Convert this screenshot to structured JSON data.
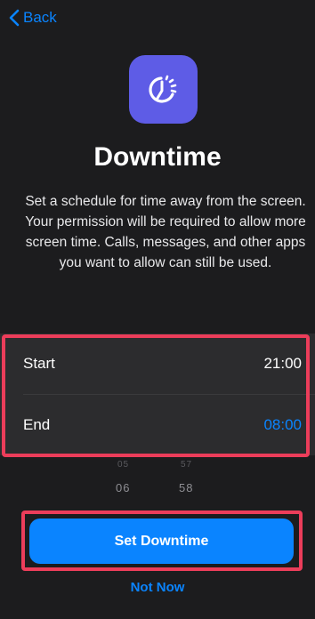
{
  "nav": {
    "back_label": "Back"
  },
  "header": {
    "icon": "downtime-icon",
    "title": "Downtime",
    "description": "Set a schedule for time away from the screen. Your permission will be required to allow more screen time. Calls, messages, and other apps you want to allow can still be used."
  },
  "schedule": {
    "start": {
      "label": "Start",
      "value": "21:00"
    },
    "end": {
      "label": "End",
      "value": "08:00"
    }
  },
  "picker": {
    "hour_above": "05",
    "hour": "06",
    "minute_above": "57",
    "minute": "58"
  },
  "actions": {
    "primary_label": "Set Downtime",
    "secondary_label": "Not Now"
  },
  "colors": {
    "accent": "#0a84ff",
    "icon_bg": "#5e5ce6",
    "highlight": "#ec3d5a",
    "background": "#1c1c1e"
  }
}
